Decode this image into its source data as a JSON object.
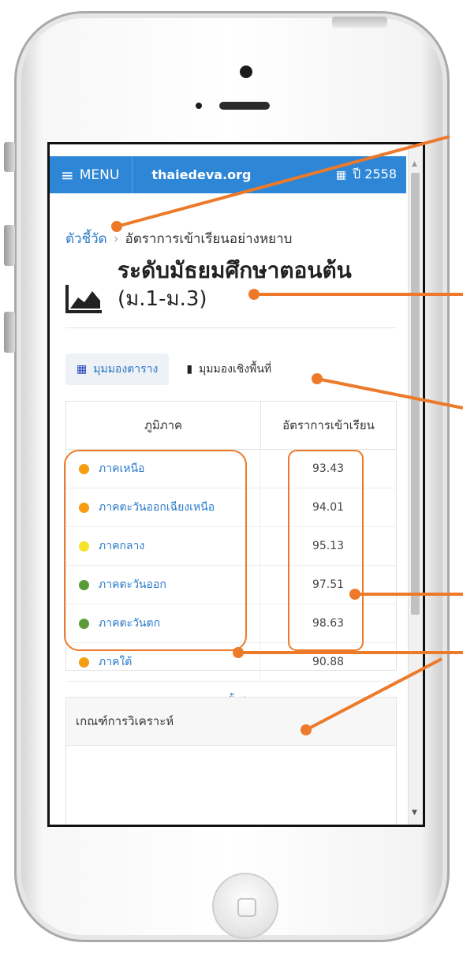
{
  "navbar": {
    "menu_label": "MENU",
    "brand": "thaiedeva.org",
    "year_label": "ปี 2558"
  },
  "breadcrumb": {
    "root": "ตัวชี้วัด",
    "current": "อัตราการเข้าเรียนอย่างหยาบ"
  },
  "page": {
    "title": "ระดับมัธยมศึกษาตอนต้น",
    "subtitle": "(ม.1-ม.3)"
  },
  "tabs": [
    {
      "label": "มุมมองตาราง",
      "icon": "grid-icon",
      "active": true
    },
    {
      "label": "มุมมองเชิงพื้นที่",
      "icon": "map-icon",
      "active": false
    }
  ],
  "table": {
    "headers": [
      "ภูมิภาค",
      "อัตราการเข้าเรียน"
    ],
    "rows": [
      {
        "region": "ภาคเหนือ",
        "value": "93.43",
        "color": "#f59c11"
      },
      {
        "region": "ภาคตะวันออกเฉียงเหนือ",
        "value": "94.01",
        "color": "#f59c11"
      },
      {
        "region": "ภาคกลาง",
        "value": "95.13",
        "color": "#f5e22a"
      },
      {
        "region": "ภาคตะวันออก",
        "value": "97.51",
        "color": "#5b9a3a"
      },
      {
        "region": "ภาคตะวันตก",
        "value": "98.63",
        "color": "#5b9a3a"
      },
      {
        "region": "ภาคใต้",
        "value": "90.88",
        "color": "#f59c11"
      }
    ],
    "footer_link": "ภาพรวมทั้งประเทศ"
  },
  "criteria": {
    "title": "เกณฑ์การวิเคราะห์"
  },
  "colors": {
    "navbar": "#2e86d6",
    "link": "#2a7ac9",
    "annotation": "#ec7a2a"
  }
}
